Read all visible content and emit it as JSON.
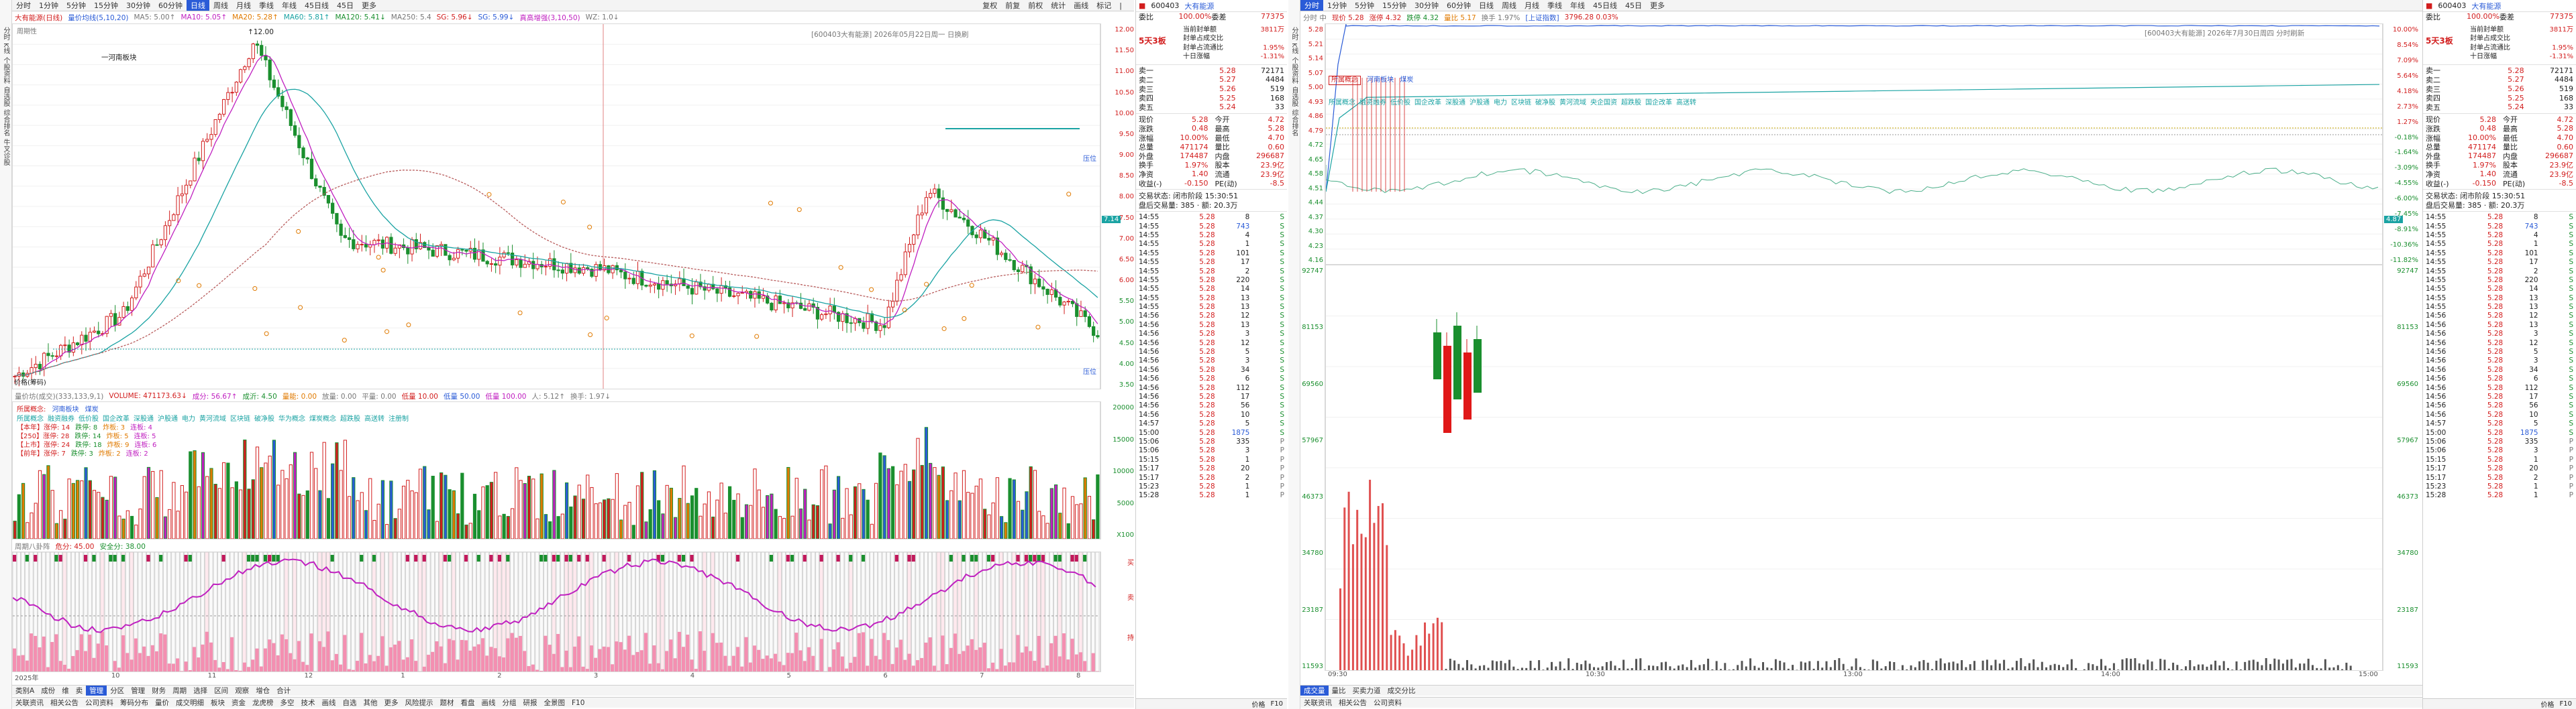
{
  "left": {
    "period_tabs": [
      "分时",
      "1分钟",
      "5分钟",
      "15分钟",
      "30分钟",
      "60分钟",
      "日线",
      "周线",
      "月线",
      "季线",
      "年线",
      "45日线",
      "45日",
      "更多"
    ],
    "active_period": "日线",
    "toolbar_right": [
      "复权",
      "前复",
      "前权",
      "统计",
      "画线",
      "标记",
      "|",
      ""
    ],
    "title_line": [
      "大有能源(日线)",
      "量价均线(5,10,20)",
      "MA5: 5.00↑",
      "MA10: 5.05↑",
      "MA20: 5.28↑",
      "MA60: 5.81↑",
      "MA120: 5.41↓",
      "MA250: 5.4",
      "SG: 5.96↓",
      "SG: 5.99↓",
      "真高增强(3,10,50)",
      "WZ: 1.0↓"
    ],
    "chart_annotation": "[600403大有能源]  2026年05月22日周一  日换刷",
    "chart_labels": {
      "top_high": "12.00",
      "sector": "一河南板块",
      "low_label": "价格(筹码)",
      "ref1": "压位",
      "ref2": "压位"
    },
    "price_axis": [
      "12.00",
      "11.50",
      "11.00",
      "10.50",
      "10.00",
      "9.50",
      "9.00",
      "8.50",
      "8.00",
      "7.50",
      "7.00",
      "6.50",
      "6.00",
      "5.50",
      "5.00",
      "4.50",
      "4.00",
      "3.50"
    ],
    "current_price_badge": "7.14",
    "volume_title": [
      "量价坊(成交)(333,133,9,1)",
      "VOLUME: 471173.63↓",
      "成分: 56.67↑",
      "成沂: 4.50",
      "量能: 0.00",
      "放量: 0.00",
      "平量: 0.00",
      "低量 10.00",
      "低量 50.00",
      "低量 100.00",
      "人: 5.12↑",
      "换手: 1.97↓"
    ],
    "volume_axis": [
      "20000",
      "15000",
      "10000",
      "5000",
      "X100"
    ],
    "sector_concepts_label": "所属概念:",
    "sector_concepts_a": [
      "河南板块",
      "煤炭"
    ],
    "concepts": [
      "所属概念",
      "融资融券",
      "低价股",
      "国企改革",
      "深股通",
      "沪股通",
      "电力",
      "黄河流域",
      "区块链",
      "破净股",
      "华为概念",
      "煤炭概念",
      "超跌股",
      "高送转",
      "注册制"
    ],
    "stats": [
      {
        "k": "【本年】涨停: 14",
        "a": "跌停: 8",
        "b": "炸板: 3",
        "c": "连板: 4"
      },
      {
        "k": "【250】涨停: 28",
        "a": "跌停: 14",
        "b": "炸板: 5",
        "c": "连板: 5"
      },
      {
        "k": "【上市】涨停: 24",
        "a": "跌停: 18",
        "b": "炸板: 9",
        "c": "连板: 6"
      },
      {
        "k": "【前年】涨停: 7",
        "a": "跌停: 3",
        "b": "炸板: 2",
        "c": "连板: 2"
      }
    ],
    "indicator_title": [
      "周期八卦阵",
      "危分: 45.00",
      "安全分: 38.00"
    ],
    "x_axis": [
      "2025年",
      "10",
      "11",
      "12",
      "1",
      "2",
      "3",
      "4",
      "5",
      "6",
      "7",
      "8"
    ],
    "bottom_tabs": [
      "类别A",
      "成份",
      "维",
      "卖",
      "管理",
      "分区",
      "管理",
      "财务",
      "周期",
      "选择",
      "区间",
      "观察",
      "增仓",
      "合计"
    ],
    "bottom_tabs_2": [
      "关联资讯",
      "相关公告",
      "公司资料",
      "筹码分布",
      "量价",
      "成交明细",
      "板块",
      "资金",
      "龙虎榜",
      "多空",
      "技术",
      "画线",
      "自选",
      "其他",
      "更多",
      "风险提示",
      "题材",
      "看盘",
      "画线",
      "分组",
      "研报",
      "全景图",
      "F10"
    ]
  },
  "left_quote": {
    "code": "600403",
    "name": "大有能源",
    "sub_left": "委比",
    "sub_mid": "100.00%",
    "sub_mid2": "委差",
    "sub_right": "77375",
    "board_tag": "5天3板",
    "board_lines": [
      "当前封单额",
      "封单占成交比",
      "封单占流通比",
      "十日涨幅"
    ],
    "board_vals": [
      "3811万",
      "",
      "1.95%",
      "-1.31%"
    ],
    "sell": [
      [
        "卖一",
        "5.28",
        "72171"
      ],
      [
        "卖二",
        "5.27",
        "4484"
      ],
      [
        "卖三",
        "5.26",
        "519"
      ],
      [
        "卖四",
        "5.25",
        "168"
      ],
      [
        "卖五",
        "5.24",
        "33"
      ]
    ],
    "info": [
      [
        "现价",
        "5.28",
        "今开",
        "4.72"
      ],
      [
        "涨跌",
        "0.48",
        "最高",
        "5.28"
      ],
      [
        "涨幅",
        "10.00%",
        "最低",
        "4.70"
      ],
      [
        "总量",
        "471174",
        "量比",
        "0.60"
      ],
      [
        "外盘",
        "174487",
        "内盘",
        "296687"
      ],
      [
        "换手",
        "1.97%",
        "股本",
        "23.9亿"
      ],
      [
        "净资",
        "1.40",
        "流通",
        "23.9亿"
      ],
      [
        "收益(-)",
        "-0.150",
        "PE(动)",
        "-8.5"
      ]
    ],
    "status": "交易状态: 闭市阶段 15:30:51",
    "status2": "盘后交易量: 385 · 额: 20.3万",
    "ticks": [
      [
        "14:55",
        "5.28",
        "8",
        "S"
      ],
      [
        "14:55",
        "5.28",
        "743",
        "S"
      ],
      [
        "14:55",
        "5.28",
        "4",
        "S"
      ],
      [
        "14:55",
        "5.28",
        "1",
        "S"
      ],
      [
        "14:55",
        "5.28",
        "101",
        "S"
      ],
      [
        "14:55",
        "5.28",
        "17",
        "S"
      ],
      [
        "14:55",
        "5.28",
        "2",
        "S"
      ],
      [
        "14:55",
        "5.28",
        "220",
        "S"
      ],
      [
        "14:55",
        "5.28",
        "14",
        "S"
      ],
      [
        "14:55",
        "5.28",
        "13",
        "S"
      ],
      [
        "14:55",
        "5.28",
        "13",
        "S"
      ],
      [
        "14:56",
        "5.28",
        "12",
        "S"
      ],
      [
        "14:56",
        "5.28",
        "13",
        "S"
      ],
      [
        "14:56",
        "5.28",
        "3",
        "S"
      ],
      [
        "14:56",
        "5.28",
        "12",
        "S"
      ],
      [
        "14:56",
        "5.28",
        "5",
        "S"
      ],
      [
        "14:56",
        "5.28",
        "3",
        "S"
      ],
      [
        "14:56",
        "5.28",
        "34",
        "S"
      ],
      [
        "14:56",
        "5.28",
        "6",
        "S"
      ],
      [
        "14:56",
        "5.28",
        "112",
        "S"
      ],
      [
        "14:56",
        "5.28",
        "17",
        "S"
      ],
      [
        "14:56",
        "5.28",
        "56",
        "S"
      ],
      [
        "14:56",
        "5.28",
        "10",
        "S"
      ],
      [
        "14:57",
        "5.28",
        "5",
        "S"
      ],
      [
        "15:00",
        "5.28",
        "1875",
        "S"
      ],
      [
        "15:06",
        "5.28",
        "335",
        "P"
      ],
      [
        "15:06",
        "5.28",
        "3",
        "P"
      ],
      [
        "15:15",
        "5.28",
        "1",
        "P"
      ],
      [
        "15:17",
        "5.28",
        "20",
        "P"
      ],
      [
        "15:17",
        "5.28",
        "2",
        "P"
      ],
      [
        "15:23",
        "5.28",
        "1",
        "P"
      ],
      [
        "15:28",
        "5.28",
        "1",
        "P"
      ]
    ],
    "foot": [
      "价格",
      "F10"
    ]
  },
  "right": {
    "period_tabs": [
      "分时",
      "1分钟",
      "5分钟",
      "15分钟",
      "30分钟",
      "60分钟",
      "日线",
      "周线",
      "月线",
      "季线",
      "年线",
      "45日线",
      "45日",
      "更多"
    ],
    "active_period": "分时",
    "title_line": [
      "分时 中",
      "现价 5.28",
      "涨停 4.32",
      "跌停 4.32",
      "量比 5.17",
      "换手 1.97%",
      "[上证指数]",
      "3796.28 0.03%"
    ],
    "chart_annotation": "[600403大有能源]  2026年7月30日周四 分时刷新",
    "concept_tag": "所属概念",
    "concepts_a": [
      "河南板块",
      "煤炭"
    ],
    "concepts": [
      "所属概念",
      "融资融券",
      "低价股",
      "国企改革",
      "深股通",
      "沪股通",
      "电力",
      "区块链",
      "破净股",
      "黄河流域",
      "央企国资",
      "超跌股",
      "国企改革",
      "高送转"
    ],
    "price_axis_left": [
      "5.28",
      "5.21",
      "5.14",
      "5.07",
      "5.00",
      "4.93",
      "4.86",
      "4.79",
      "4.72",
      "4.65",
      "4.58",
      "4.51",
      "4.44",
      "4.37",
      "4.30",
      "4.23",
      "4.16"
    ],
    "price_axis_right": [
      "10.00%",
      "8.54%",
      "7.09%",
      "5.64%",
      "4.18%",
      "2.73%",
      "1.27%",
      "-0.18%",
      "-1.64%",
      "-3.09%",
      "-4.55%",
      "-6.00%",
      "-7.45%",
      "-8.91%",
      "-10.36%",
      "-11.82%"
    ],
    "badge": "4.87",
    "vol_axis": [
      "92747",
      "81153",
      "69560",
      "57967",
      "46373",
      "34780",
      "23187",
      "11593"
    ],
    "x_axis": [
      "09:30",
      "10:30",
      "13:00",
      "14:00",
      "15:00"
    ],
    "bottom_tabs": [
      "成交量",
      "量比",
      "买卖力道",
      "成交分比"
    ],
    "bottom_tabs_2": [
      "关联资讯",
      "相关公告",
      "公司资料"
    ]
  },
  "right_quote": {
    "code": "600403",
    "name": "大有能源",
    "sub_left": "委比",
    "sub_mid": "100.00%",
    "sub_mid2": "委差",
    "sub_right": "77375",
    "board_tag": "5天3板",
    "board_lines": [
      "当前封单额",
      "封单占成交比",
      "封单占流通比",
      "十日涨幅"
    ],
    "board_vals": [
      "3811万",
      "",
      "1.95%",
      "-1.31%"
    ],
    "sell": [
      [
        "卖一",
        "5.28",
        "72171"
      ],
      [
        "卖二",
        "5.27",
        "4484"
      ],
      [
        "卖三",
        "5.26",
        "519"
      ],
      [
        "卖四",
        "5.25",
        "168"
      ],
      [
        "卖五",
        "5.24",
        "33"
      ]
    ],
    "info": [
      [
        "现价",
        "5.28",
        "今开",
        "4.72"
      ],
      [
        "涨跌",
        "0.48",
        "最高",
        "5.28"
      ],
      [
        "涨幅",
        "10.00%",
        "最低",
        "4.70"
      ],
      [
        "总量",
        "471174",
        "量比",
        "0.60"
      ],
      [
        "外盘",
        "174487",
        "内盘",
        "296687"
      ],
      [
        "换手",
        "1.97%",
        "股本",
        "23.9亿"
      ],
      [
        "净资",
        "1.40",
        "流通",
        "23.9亿"
      ],
      [
        "收益(-)",
        "-0.150",
        "PE(动)",
        "-8.5"
      ]
    ],
    "status": "交易状态: 闭市阶段 15:30:51",
    "status2": "盘后交易量: 385 · 额: 20.3万",
    "foot": [
      "价格",
      "F10"
    ]
  },
  "colors": {
    "up": "#d21e1e",
    "down": "#1a8f2e",
    "accent": "#2a5bd7",
    "ma_magenta": "#c020c0",
    "ma_teal": "#1aa3a3"
  }
}
